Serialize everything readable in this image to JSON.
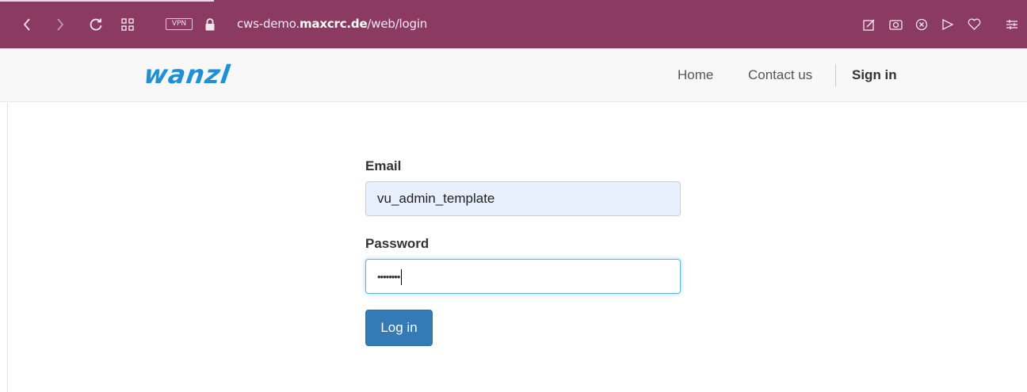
{
  "browser": {
    "vpn_label": "VPN",
    "url_prefix": "cws-demo.",
    "url_domain": "maxcrc.de",
    "url_path": "/web/login",
    "icons": [
      "back-icon",
      "forward-icon",
      "reload-icon",
      "tabs-grid-icon",
      "lock-icon",
      "edit-icon",
      "camera-icon",
      "shield-icon",
      "send-icon",
      "heart-icon",
      "menu-icon"
    ]
  },
  "navbar": {
    "logo": "wanzl",
    "links": {
      "home": "Home",
      "contact": "Contact us",
      "signin": "Sign in"
    },
    "logo_color": "#1f8fd6"
  },
  "form": {
    "email_label": "Email",
    "email_value": "vu_admin_template",
    "password_label": "Password",
    "password_masked": "••••••••",
    "login_label": "Log in"
  },
  "colors": {
    "browser_bar": "#8b3a62",
    "primary_button": "#337ab7"
  }
}
